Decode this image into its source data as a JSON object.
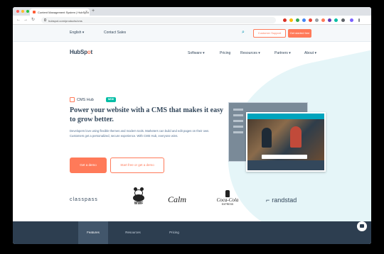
{
  "browser": {
    "tab_title": "Content Management System | HubSpot",
    "new_tab": "+",
    "close": "×",
    "url": "hubspot.com/products/cms",
    "nav": {
      "back": "←",
      "forward": "→",
      "reload": "↻"
    }
  },
  "utility_bar": {
    "language": "English ▾",
    "contact": "Contact Sales",
    "search_icon": "search-icon",
    "login": "Customer Support",
    "get_started": "Get started free"
  },
  "nav": {
    "logo_pre": "HubSp",
    "logo_o": "o",
    "logo_post": "t",
    "items": [
      "Software ▾",
      "Pricing",
      "Resources ▾",
      "Partners ▾",
      "About ▾"
    ]
  },
  "hero": {
    "hub_label": "CMS Hub",
    "badge": "NEW",
    "headline": "Power your website with a CMS that makes it easy to grow better.",
    "body": "Developers love using flexible themes and modern tools. Marketers can build and edit pages on their own. Customers get a personalized, secure experience. With CMS Hub, everyone wins.",
    "cta_primary": "Get a demo",
    "cta_secondary": "Start free or get a demo"
  },
  "logos": {
    "classpass": "classpass",
    "wwf": "WWF",
    "calm": "Calm",
    "coke": "Coca-Cola",
    "coke_sub": "EXPRESS",
    "randstad": "randstad"
  },
  "bottom_tabs": [
    "Features",
    "Resources",
    "Pricing"
  ],
  "colors": {
    "accent": "#ff7a59",
    "navy": "#33475b",
    "teal": "#00bda5",
    "bar": "#2d3e50"
  }
}
